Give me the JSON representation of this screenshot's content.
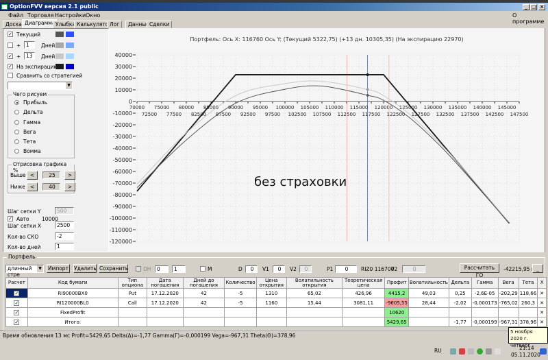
{
  "window": {
    "title": "OptionFVV версия 2.1 public"
  },
  "menu": {
    "items": [
      "Файл",
      "Торговля",
      "Настройки",
      "Окно"
    ],
    "about": "О программе"
  },
  "tabs": [
    "Доска",
    "Диаграмма",
    "Улыбка",
    "Калькулятор",
    "Лог",
    "Данные",
    "Сделки"
  ],
  "active_tab": "Диаграмма",
  "left": {
    "curves": [
      {
        "label": "Текущий",
        "checked": true,
        "has_days": false,
        "colors": [
          "#555555",
          "#2e4fff"
        ]
      },
      {
        "label": "Дней",
        "checked": false,
        "plus": "+",
        "days": "1",
        "colors": [
          "#a8a8a8",
          "#78a8ff"
        ]
      },
      {
        "label": "Дней",
        "checked": true,
        "plus": "+",
        "days": "13",
        "colors": [
          "#c8c8c8",
          "#a8d8ff"
        ]
      },
      {
        "label": "На экспирацию",
        "checked": true,
        "has_days": false,
        "colors": [
          "#1a1a1a",
          "#0000c0"
        ]
      }
    ],
    "compare": "Сравнить со стратегией",
    "draw_group": {
      "caption": "Чего рисуем",
      "options": [
        "Прибыль",
        "Дельта",
        "Гамма",
        "Вега",
        "Тета",
        "Вомма"
      ],
      "selected": "Прибыль"
    },
    "range_group": {
      "caption": "Отрисовка графика %",
      "above_label": "Выше",
      "above": "25",
      "below_label": "Ниже",
      "below": "40",
      "prev": "<",
      "next": ">"
    },
    "grid_y_label": "Шаг сетки Y",
    "grid_y": "500",
    "auto_label": "Авто",
    "auto_value": "10000",
    "grid_x_label": "Шаг сетки X",
    "grid_x": "2500",
    "sko_label": "Кол-во СКО",
    "sko": "-2",
    "days_label": "Кол-во дней",
    "days": "1"
  },
  "chart_data": {
    "type": "line",
    "title": "Портфель: Ось X: 116760 Ось Y:  (Текущий 5322,75)  (+13 дн. 10305,35)  (На экспирацию 22970)",
    "annotation": "без страховки",
    "xlim": [
      70000,
      147500
    ],
    "ylim": [
      -120000,
      40000
    ],
    "x_ticks_upper": [
      "70000",
      "75000",
      "80000",
      "85000",
      "90000",
      "95000",
      "100000",
      "105000",
      "110000",
      "115000",
      "120000",
      "125000",
      "130000",
      "135000",
      "140000",
      "145000"
    ],
    "x_ticks_lower": [
      "72500",
      "77500",
      "82500",
      "87500",
      "92500",
      "97500",
      "102500",
      "107500",
      "112500",
      "117500",
      "122500",
      "127500",
      "132500",
      "137500",
      "142500",
      "147500"
    ],
    "y_ticks": [
      "40000",
      "30000",
      "20000",
      "10000",
      "0",
      "-10000",
      "-20000",
      "-30000",
      "-40000",
      "-50000",
      "-60000",
      "-70000",
      "-80000",
      "-90000",
      "-100000",
      "-110000",
      "-120000"
    ],
    "grid": true,
    "current_x": 116760,
    "range_lines_x": [
      112600,
      121100
    ],
    "series": [
      {
        "name": "На экспирацию",
        "color": "#1a1a1a",
        "x": [
          70000,
          90000,
          120000,
          145500
        ],
        "y": [
          -77030,
          22970,
          22970,
          -104530
        ]
      },
      {
        "name": "+13 дн.",
        "color": "#c8c8c8",
        "x": [
          70000,
          80000,
          90000,
          100000,
          107500,
          116760,
          120000,
          125000,
          130000,
          135000,
          145500
        ],
        "y": [
          -71000,
          -27000,
          5000,
          15300,
          17300,
          10305,
          5000,
          -10000,
          -30000,
          -52000,
          -104000
        ]
      },
      {
        "name": "Текущий",
        "color": "#555555",
        "x": [
          70000,
          80000,
          90000,
          100000,
          107500,
          116760,
          120000,
          125000,
          130000,
          135000,
          145500
        ],
        "y": [
          -74000,
          -33000,
          -1500,
          10500,
          13200,
          5323,
          1000,
          -13000,
          -32000,
          -54000,
          -104500
        ]
      }
    ]
  },
  "portfolio": {
    "caption": "Портфель",
    "strategy": "длинный стре",
    "import": "Импорт",
    "delete": "Удалить",
    "save": "Сохранить",
    "dh": "DH",
    "dh_a": "0",
    "dh_b": "1",
    "m": "M",
    "d_label": "D",
    "d": "0",
    "v1_label": "V1",
    "v1": "0",
    "v2_label": "V2",
    "v2": "0",
    "p1_label": "P1",
    "p1": "0",
    "ticker": "RIZ0 116700",
    "p2_label": "P2",
    "p2": "0",
    "calc_go": "Рассчитать ГО",
    "go_value": "-42215,95 п.",
    "minimize": "_",
    "columns": [
      "Расчет",
      "Код бумаги",
      "Тип опциона",
      "Дата погашения",
      "Дней до погашения",
      "Количество",
      "Цена открытия",
      "Волатильность открытия",
      "Теоретическая цена",
      "Профит",
      "Волатильность",
      "Дельта",
      "Гамма",
      "Вега",
      "Тета",
      "X"
    ],
    "rows": [
      {
        "cells": [
          "RI90000BX0",
          "Put",
          "17.12.2020",
          "42",
          "-5",
          "1310",
          "65,02",
          "426,96",
          "4415,2",
          "49,03",
          "0,25",
          "-2,6E-05",
          "-202,29",
          "118,66"
        ],
        "profit_state": "pos",
        "selected": true
      },
      {
        "cells": [
          "RI120000BL0",
          "Call",
          "17.12.2020",
          "42",
          "-5",
          "1160",
          "15,44",
          "3081,11",
          "-9605,55",
          "28,44",
          "-2,02",
          "-0,000173",
          "-765,02",
          "260,3"
        ],
        "profit_state": "neg"
      },
      {
        "cells": [
          "FixedProfit",
          "",
          "",
          "",
          "",
          "",
          "",
          "",
          "10620",
          "",
          "",
          "",
          "",
          ""
        ],
        "profit_state": "pos"
      },
      {
        "cells": [
          "Итого:",
          "",
          "",
          "",
          "",
          "",
          "",
          "",
          "5429,65",
          "",
          "-1,77",
          "-0,000199",
          "-967,31",
          "378,96"
        ],
        "profit_state": "pos"
      }
    ],
    "delete_glyph": "✕"
  },
  "status": "Время обновления 13 мс  Profit=5429,65 Delta(Δ)=-1,77 Gamma(Γ)=-0,000199 Vega=-967,31 Theta(Θ)=378,96",
  "tooltip": {
    "line1": "5 ноября 2020 г.",
    "line2": "четверг"
  },
  "taskbar": {
    "lang": "RU",
    "time": "21:14",
    "date": "05.11.2020"
  }
}
